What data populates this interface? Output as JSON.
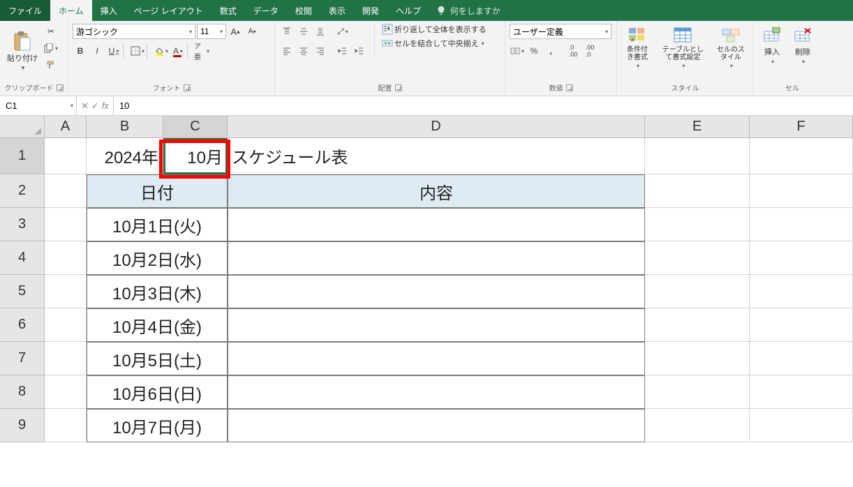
{
  "tabs": {
    "file": "ファイル",
    "home": "ホーム",
    "insert": "挿入",
    "pageLayout": "ページ レイアウト",
    "formulas": "数式",
    "data": "データ",
    "review": "校閲",
    "view": "表示",
    "developer": "開発",
    "help": "ヘルプ",
    "tellme": "何をしますか"
  },
  "ribbon": {
    "clipboard": {
      "paste": "貼り付け",
      "label": "クリップボード"
    },
    "font": {
      "name": "游ゴシック",
      "size": "11",
      "label": "フォント"
    },
    "alignment": {
      "wrap": "折り返して全体を表示する",
      "merge": "セルを結合して中央揃え",
      "label": "配置"
    },
    "number": {
      "format": "ユーザー定義",
      "label": "数値"
    },
    "styles": {
      "cond": "条件付き書式",
      "table": "テーブルとして書式設定",
      "cell": "セルのスタイル",
      "label": "スタイル"
    },
    "cells": {
      "insert": "挿入",
      "delete": "削除",
      "label": "セル"
    }
  },
  "formulaBar": {
    "nameBox": "C1",
    "value": "10"
  },
  "columns": [
    "A",
    "B",
    "C",
    "D",
    "E",
    "F"
  ],
  "rowNums": [
    "1",
    "2",
    "3",
    "4",
    "5",
    "6",
    "7",
    "8",
    "9"
  ],
  "sheet": {
    "B1": "2024年",
    "C1": "10月",
    "D1": "スケジュール表",
    "header_date": "日付",
    "header_content": "内容",
    "dates": [
      "10月1日(火)",
      "10月2日(水)",
      "10月3日(木)",
      "10月4日(金)",
      "10月5日(土)",
      "10月6日(日)",
      "10月7日(月)"
    ]
  },
  "selection": {
    "cell": "C1"
  }
}
